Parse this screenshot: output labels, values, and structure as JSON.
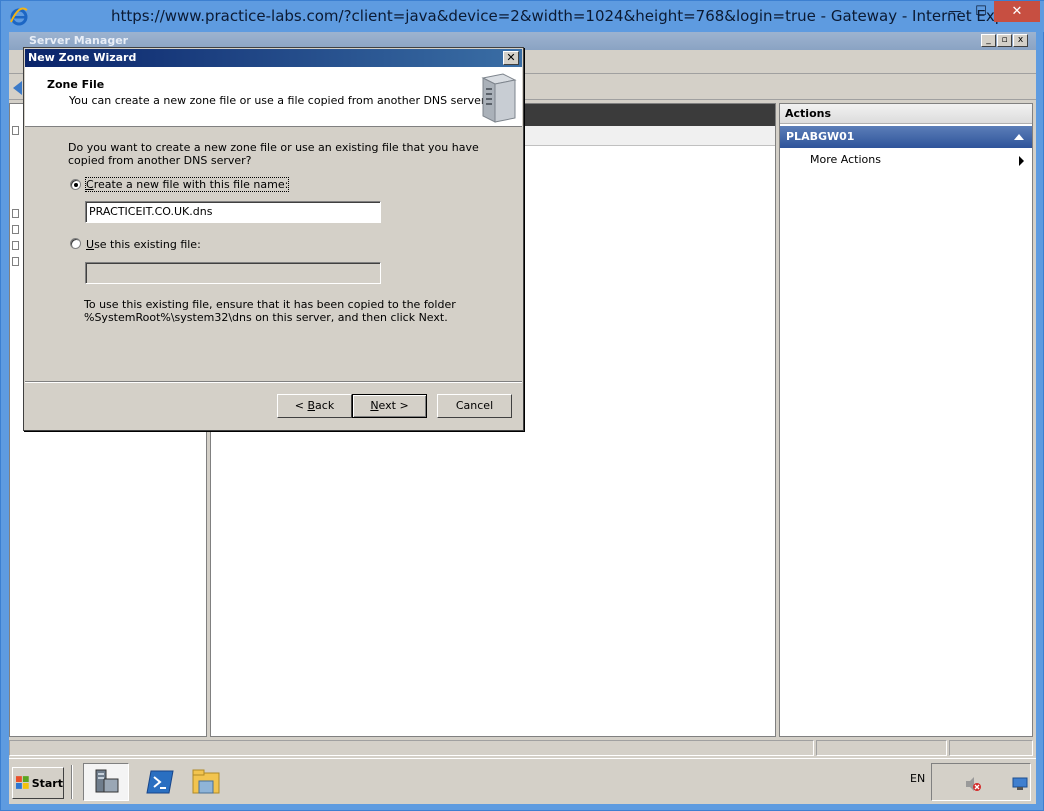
{
  "browser": {
    "title": "https://www.practice-labs.com/?client=java&device=2&width=1024&height=768&login=true - Gateway  - Internet Explorer"
  },
  "server_manager": {
    "title": "Server Manager",
    "actions": {
      "header": "Actions",
      "server": "PLABGW01",
      "more_actions": "More Actions"
    }
  },
  "dialog": {
    "title": "New Zone Wizard",
    "close_glyph": "✕",
    "heading": "Zone File",
    "subheading": "You can create a new zone file or use a file copied from another DNS server.",
    "question": "Do you want to create a new zone file or use an existing file that you have copied from another DNS server?",
    "option_new": {
      "label_prefix": "",
      "label_access": "C",
      "label_rest": "reate a new file with this file name:",
      "checked": true,
      "value": "PRACTICEIT.CO.UK.dns"
    },
    "option_existing": {
      "label_access": "U",
      "label_rest": "se this existing file:",
      "checked": false,
      "value": ""
    },
    "note": "To use this existing file, ensure that it has been copied to the folder %SystemRoot%\\system32\\dns on this server, and then click Next.",
    "buttons": {
      "back_prefix": "< ",
      "back_access": "B",
      "back_rest": "ack",
      "next_access": "N",
      "next_rest": "ext >",
      "cancel": "Cancel"
    }
  },
  "taskbar": {
    "start": "Start",
    "language": "EN"
  },
  "colors": {
    "ie_frame": "#5e9be0",
    "dialog_title": "#0a246a",
    "actions_server_bar": "#2e539a"
  },
  "icons": [
    "ie-logo-icon",
    "server-tower-icon",
    "windows-flag-icon",
    "server-manager-icon",
    "powershell-icon",
    "file-explorer-icon",
    "speaker-muted-icon",
    "network-icon"
  ]
}
